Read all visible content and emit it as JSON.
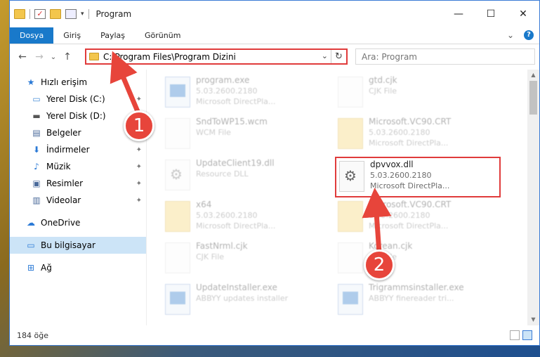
{
  "window": {
    "title": "Program",
    "minimize": "—",
    "maximize": "☐",
    "close": "✕"
  },
  "ribbon": {
    "tabs": [
      "Dosya",
      "Giriş",
      "Paylaş",
      "Görünüm"
    ],
    "expand": "⌄",
    "help": "?"
  },
  "nav": {
    "back": "←",
    "forward": "→",
    "recent": "⌄",
    "up": "↑",
    "address": "C:\\Program Files\\Program Dizini",
    "dropdown": "⌄",
    "refresh": "↻",
    "search_placeholder": "Ara: Program"
  },
  "sidebar": {
    "items": [
      {
        "label": "Hızlı erişim",
        "icon": "★"
      },
      {
        "label": "Yerel Disk (C:)",
        "icon": "▭"
      },
      {
        "label": "Yerel Disk (D:)",
        "icon": "▬"
      },
      {
        "label": "Belgeler",
        "icon": "▤"
      },
      {
        "label": "İndirmeler",
        "icon": "⬇"
      },
      {
        "label": "Müzik",
        "icon": "♪"
      },
      {
        "label": "Resimler",
        "icon": "▣"
      },
      {
        "label": "Videolar",
        "icon": "▥"
      },
      {
        "label": "OneDrive",
        "icon": "☁"
      },
      {
        "label": "Bu bilgisayar",
        "icon": "▭"
      },
      {
        "label": "Ağ",
        "icon": "⊞"
      }
    ],
    "pin": "📌"
  },
  "files": [
    {
      "name": "program.exe",
      "line1": "5.03.2600.2180",
      "line2": "Microsoft DirectPla..."
    },
    {
      "name": "gtd.cjk",
      "line1": "CJK File",
      "line2": ""
    },
    {
      "name": "SndToWP15.wcm",
      "line1": "WCM File",
      "line2": ""
    },
    {
      "name": "Microsoft.VC90.CRT",
      "line1": "5.03.2600.2180",
      "line2": "Microsoft DirectPla..."
    },
    {
      "name": "UpdateClient19.dll",
      "line1": "Resource DLL",
      "line2": ""
    },
    {
      "name": "dpvvox.dll",
      "line1": "5.03.2600.2180",
      "line2": "Microsoft DirectPla..."
    },
    {
      "name": "x64",
      "line1": "5.03.2600.2180",
      "line2": "Microsoft DirectPla..."
    },
    {
      "name": "Microsoft.VC90.CRT",
      "line1": "5.03.2600.2180",
      "line2": "Microsoft DirectPla..."
    },
    {
      "name": "FastNrml.cjk",
      "line1": "CJK File",
      "line2": ""
    },
    {
      "name": "Korean.cjk",
      "line1": "CJK File",
      "line2": ""
    },
    {
      "name": "UpdateInstaller.exe",
      "line1": "ABBYY updates installer",
      "line2": ""
    },
    {
      "name": "Trigrammsinstaller.exe",
      "line1": "ABBYY finereader tri...",
      "line2": ""
    }
  ],
  "status": {
    "count": "184 öğe"
  },
  "annotations": {
    "step1": "1",
    "step2": "2"
  },
  "colors": {
    "accent": "#1979ca",
    "highlight": "#e03b3b",
    "callout": "#e7453b"
  }
}
